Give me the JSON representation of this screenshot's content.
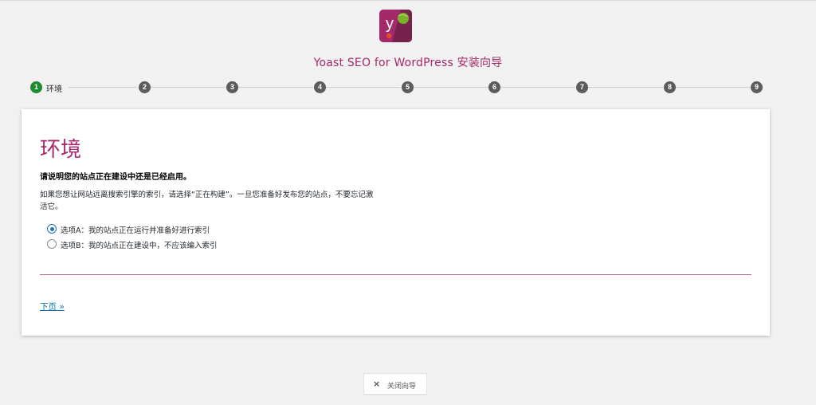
{
  "logo": {
    "letter": "y"
  },
  "header": {
    "title": "Yoast SEO for WordPress 安装向导"
  },
  "stepper": {
    "steps": [
      "1",
      "2",
      "3",
      "4",
      "5",
      "6",
      "7",
      "8",
      "9"
    ],
    "active_label": "环境"
  },
  "card": {
    "title": "环境",
    "question": "请说明您的站点正在建设中还是已经启用。",
    "description": "如果您想让网站远离搜索引擎的索引，请选择“正在构建”。一旦您准备好发布您的站点，不要忘记激活它。",
    "options": [
      {
        "label": "选项A：我的站点正在运行并准备好进行索引",
        "checked": true
      },
      {
        "label": "选项B：我的站点正在建设中，不应该编入索引",
        "checked": false
      }
    ],
    "next_link": "下页 »"
  },
  "footer": {
    "close_label": "关闭向导",
    "close_icon": "×"
  },
  "colors": {
    "brand": "#a4286a",
    "active_step": "#1d8b2e",
    "link": "#0073aa"
  }
}
